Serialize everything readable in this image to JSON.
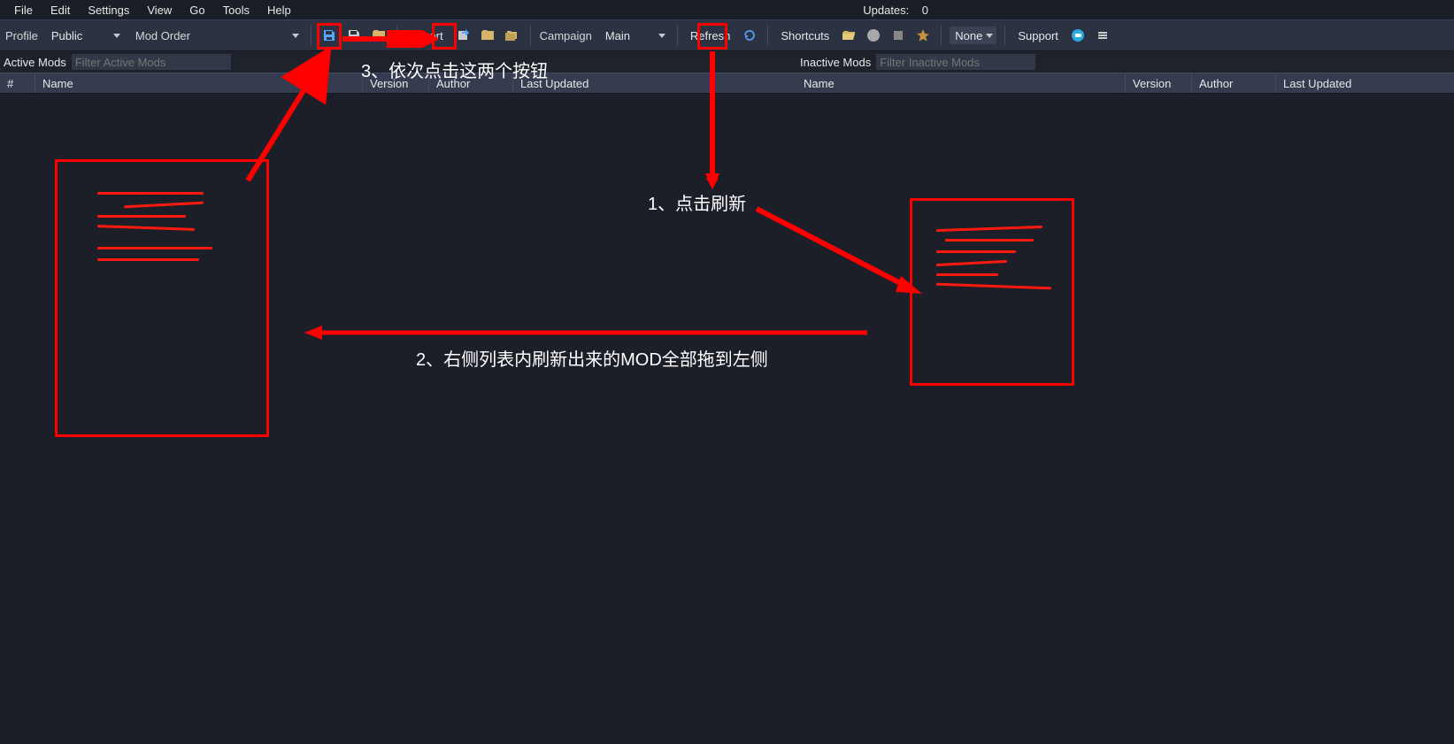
{
  "menu": {
    "file": "File",
    "edit": "Edit",
    "settings": "Settings",
    "view": "View",
    "go": "Go",
    "tools": "Tools",
    "help": "Help",
    "updates_label": "Updates:",
    "updates_count": "0"
  },
  "toolbar": {
    "profile_label": "Profile",
    "profile_value": "Public",
    "modorder_label": "Mod Order",
    "modorder_value": "",
    "export_label": "Export",
    "campaign_label": "Campaign",
    "campaign_value": "Main",
    "refresh_label": "Refresh",
    "shortcuts_label": "Shortcuts",
    "none_label": "None",
    "support_label": "Support"
  },
  "panes": {
    "active_title": "Active Mods",
    "active_filter_placeholder": "Filter Active Mods",
    "inactive_title": "Inactive Mods",
    "inactive_filter_placeholder": "Filter Inactive Mods",
    "cols_active": {
      "num": "#",
      "name": "Name",
      "version": "Version",
      "author": "Author",
      "last_updated": "Last Updated"
    },
    "cols_inactive": {
      "name": "Name",
      "version": "Version",
      "author": "Author",
      "last_updated": "Last Updated"
    }
  },
  "annotations": {
    "step1": "1、点击刷新",
    "step2": "2、右侧列表内刷新出来的MOD全部拖到左侧",
    "step3": "3、依次点击这两个按钮"
  }
}
